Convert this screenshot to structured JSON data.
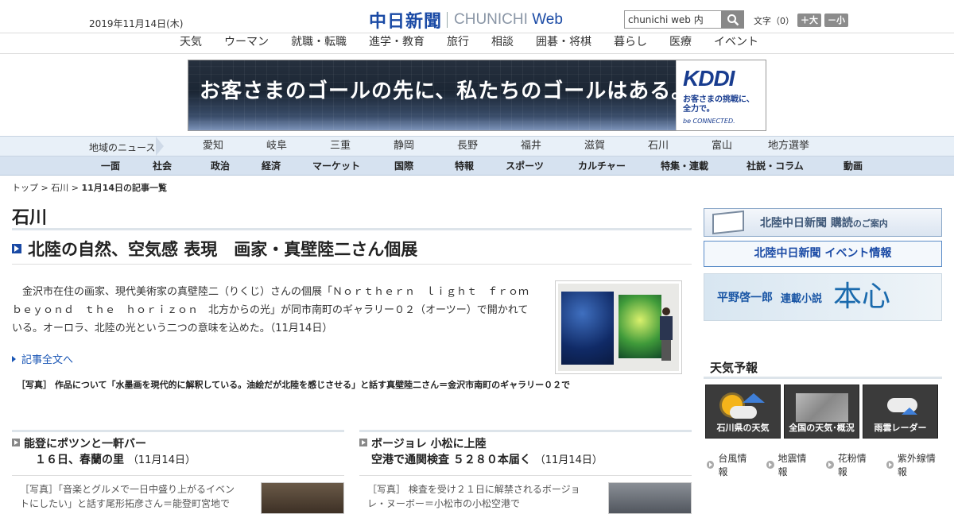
{
  "header": {
    "date": "2019年11月14日(木)",
    "logo_jp": "中日新聞",
    "logo_en": "CHUNICHI",
    "logo_web": "Web",
    "search_value": "chunichi web 内",
    "font_label": "文字（",
    "font_count": "0",
    "font_close": "）",
    "font_up": "＋大",
    "font_down": "－小"
  },
  "nav_top": [
    "天気",
    "ウーマン",
    "就職・転職",
    "進学・教育",
    "旅行",
    "相談",
    "囲碁・将棋",
    "暮らし",
    "医療",
    "イベント"
  ],
  "ad": {
    "copy": "お客さまのゴールの先に、私たちのゴールはある。",
    "brand": "KDDI",
    "tag1": "お客さまの挑戦に、",
    "tag2": "全力で。",
    "tag3": "be CONNECTED."
  },
  "region": {
    "label": "地域のニュース",
    "items": [
      "愛知",
      "岐阜",
      "三重",
      "静岡",
      "長野",
      "福井",
      "滋賀",
      "石川",
      "富山",
      "地方選挙"
    ]
  },
  "categories": [
    "一面",
    "社会",
    "政治",
    "経済",
    "マーケット",
    "国際",
    "特報",
    "スポーツ",
    "カルチャー",
    "特集・連載",
    "社説・コラム",
    "動画"
  ],
  "breadcrumb": {
    "top": "トップ",
    "sep": " > ",
    "pref": "石川",
    "current": "11月14日の記事一覧"
  },
  "section_title": "石川",
  "article": {
    "title": "北陸の自然、空気感 表現　画家・真壁陸二さん個展",
    "lead": "金沢市在住の画家、現代美術家の真壁陸二（りくじ）さんの個展「Ｎｏｒｔｈｅｒｎ　ｌｉｇｈｔ　ｆｒｏｍ　ｂｅｙｏｎｄ　ｔｈｅ　ｈｏｒｉｚｏｎ　北方からの光」が同市南町のギャラリー０２（オーツー）で開かれている。オーロラ、北陸の光という二つの意味を込めた。（11月14日）",
    "more": "記事全文へ",
    "caption": "［写真］ 作品について「水墨画を現代的に解釈している。油絵だが北陸を感じさせる」と話す真壁陸二さん＝金沢市南町のギャラリー０２で"
  },
  "sub_articles": [
    {
      "line1": "能登にポツンと一軒バー",
      "line2": "１６日、春蘭の里",
      "date": "（11月14日）",
      "text": "［写真］「音楽とグルメで一日中盛り上がるイベントにしたい」と話す尾形拓彦さん＝能登町宮地で"
    },
    {
      "line1": "ボージョレ 小松に上陸",
      "line2": "空港で通関検査 ５２８０本届く",
      "date": "（11月14日）",
      "text": "［写真］ 検査を受け２１日に解禁されるボージョレ・ヌーボー＝小松市の小松空港で"
    }
  ],
  "sidebar": {
    "subscribe": "北陸中日新聞 購読",
    "subscribe_small": "のご案内",
    "event": "北陸中日新聞 イベント情報",
    "novel_author": "平野啓一郎",
    "novel_label": "連載小説",
    "novel_title": "本心",
    "weather_title": "天気予報",
    "weather_tiles": [
      "石川県の天気",
      "全国の天気･概況",
      "雨雲レーダー"
    ],
    "links": [
      "台風情報",
      "地震情報",
      "花粉情報",
      "紫外線情報"
    ]
  }
}
